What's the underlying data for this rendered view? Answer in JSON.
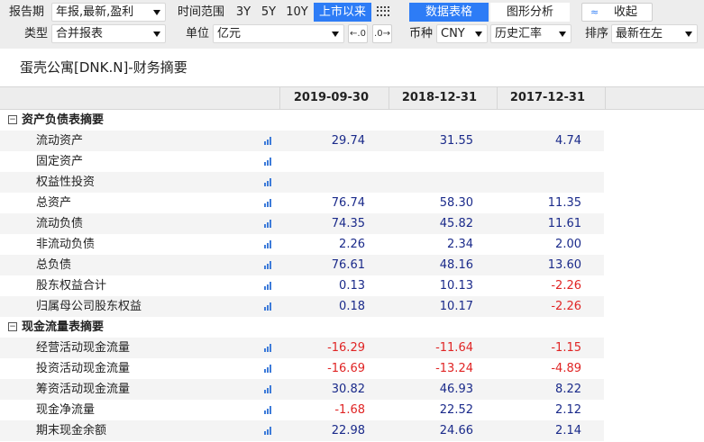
{
  "toolbar": {
    "report_period_label": "报告期",
    "report_period_value": "年报,最新,盈利",
    "time_range_label": "时间范围",
    "time_ranges": [
      "3Y",
      "5Y",
      "10Y",
      "上市以来"
    ],
    "time_range_selected": "上市以来",
    "view_tabs": [
      "数据表格",
      "图形分析"
    ],
    "view_selected": "数据表格",
    "collapse_label": "收起",
    "collapse_icon": "double-chevron-up",
    "type_label": "类型",
    "type_value": "合并报表",
    "unit_label": "单位",
    "unit_value": "亿元",
    "currency_label": "币种",
    "currency_value": "CNY",
    "rate_value": "历史汇率",
    "sort_label": "排序",
    "sort_value": "最新在左",
    "accent_color": "#2d7cf6"
  },
  "page_title": "蛋壳公寓[DNK.N]-财务摘要",
  "table": {
    "columns": [
      "2019-09-30",
      "2018-12-31",
      "2017-12-31"
    ],
    "sections": [
      {
        "title": "资产负债表摘要",
        "toggle": "−",
        "rows": [
          {
            "label": "流动资产",
            "values": [
              "29.74",
              "31.55",
              "4.74"
            ]
          },
          {
            "label": "固定资产",
            "values": [
              "",
              "",
              ""
            ]
          },
          {
            "label": "权益性投资",
            "values": [
              "",
              "",
              ""
            ]
          },
          {
            "label": "总资产",
            "values": [
              "76.74",
              "58.30",
              "11.35"
            ]
          },
          {
            "label": "流动负债",
            "values": [
              "74.35",
              "45.82",
              "11.61"
            ]
          },
          {
            "label": "非流动负债",
            "values": [
              "2.26",
              "2.34",
              "2.00"
            ]
          },
          {
            "label": "总负债",
            "values": [
              "76.61",
              "48.16",
              "13.60"
            ]
          },
          {
            "label": "股东权益合计",
            "values": [
              "0.13",
              "10.13",
              "-2.26"
            ]
          },
          {
            "label": "归属母公司股东权益",
            "values": [
              "0.18",
              "10.17",
              "-2.26"
            ]
          }
        ]
      },
      {
        "title": "现金流量表摘要",
        "toggle": "−",
        "rows": [
          {
            "label": "经营活动现金流量",
            "values": [
              "-16.29",
              "-11.64",
              "-1.15"
            ]
          },
          {
            "label": "投资活动现金流量",
            "values": [
              "-16.69",
              "-13.24",
              "-4.89"
            ]
          },
          {
            "label": "筹资活动现金流量",
            "values": [
              "30.82",
              "46.93",
              "8.22"
            ]
          },
          {
            "label": "现金净流量",
            "values": [
              "-1.68",
              "22.52",
              "2.12"
            ]
          },
          {
            "label": "期末现金余额",
            "values": [
              "22.98",
              "24.66",
              "2.14"
            ]
          }
        ]
      }
    ],
    "positive_color": "#1a2a8a",
    "negative_color": "#e02424"
  }
}
